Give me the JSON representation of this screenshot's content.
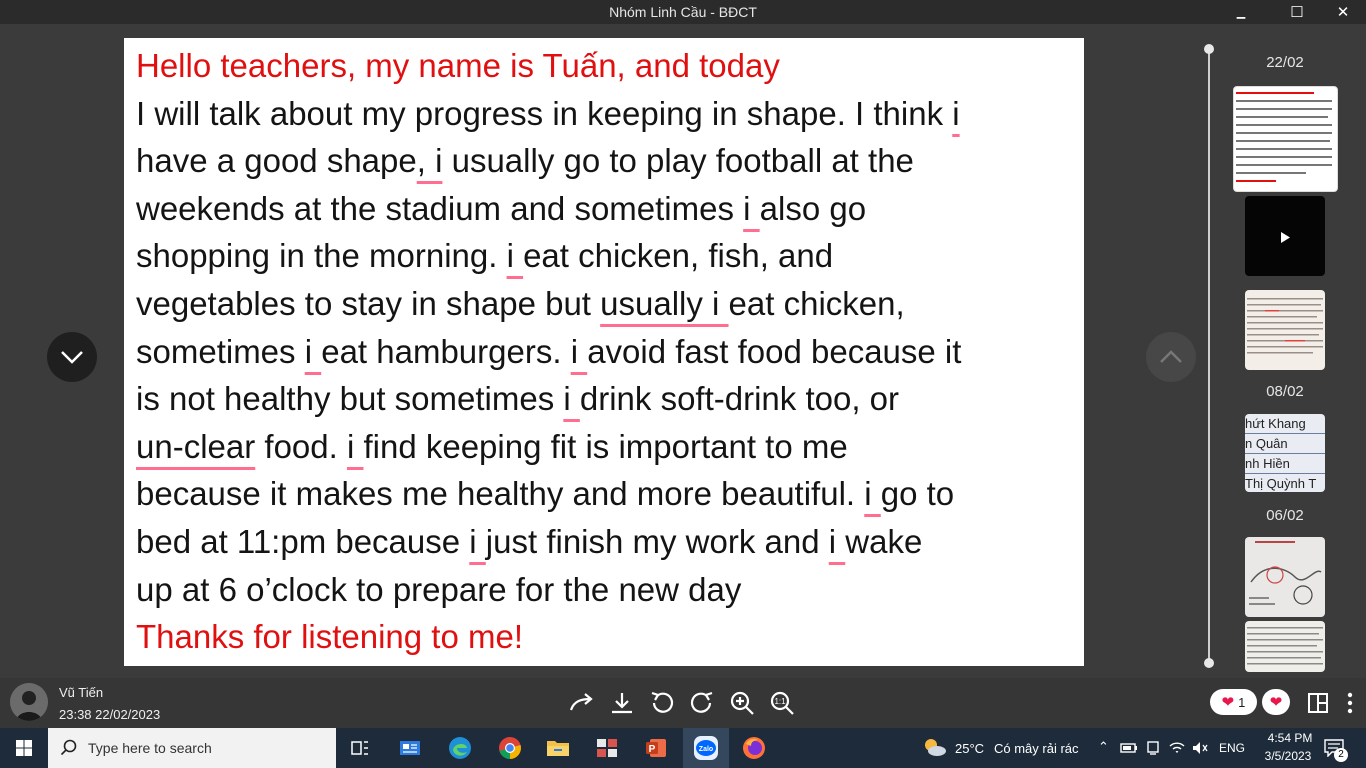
{
  "window": {
    "title": "Nhóm Linh Cầu - BĐCT",
    "minimize": "▁",
    "maximize": "☐",
    "close": "✕"
  },
  "document": {
    "greeting": "Hello teachers, my name is Tuấn, and today",
    "closing": "Thanks for listening to me!"
  },
  "sidebar": {
    "dates": [
      "22/02",
      "08/02",
      "06/02"
    ],
    "names": [
      "hứt Khang",
      "n Quân",
      "nh Hiền",
      "Thị Quỳnh T"
    ]
  },
  "message": {
    "sender": "Vũ Tiến",
    "time": "23:38 22/02/2023"
  },
  "toolbar": {
    "zoom_actual": "1:1"
  },
  "reaction": {
    "count": "1"
  },
  "taskbar": {
    "search_placeholder": "Type here to search",
    "temperature": "25°C",
    "weather": "Có mây rải rác",
    "language": "ENG",
    "time": "4:54 PM",
    "date": "3/5/2023",
    "notification_count": "2"
  },
  "colors": {
    "accent_red": "#e01010",
    "squiggle": "#ff6e8e",
    "bar_bg": "#363636",
    "taskbar_bg": "#1d2b3a"
  },
  "icons": [
    "chevron-down-icon",
    "chevron-up-icon",
    "share-arrow-icon",
    "download-icon",
    "rotate-left-icon",
    "rotate-right-icon",
    "zoom-in-icon",
    "zoom-actual-icon",
    "heart-icon",
    "split-view-icon",
    "more-vertical-icon",
    "windows-icon",
    "search-icon",
    "task-view-icon",
    "edge-icon",
    "chrome-icon",
    "file-explorer-icon",
    "powerpoint-icon",
    "zalo-icon",
    "firefox-icon",
    "weather-icon",
    "wifi-icon",
    "volume-icon",
    "battery-icon",
    "notification-icon"
  ]
}
